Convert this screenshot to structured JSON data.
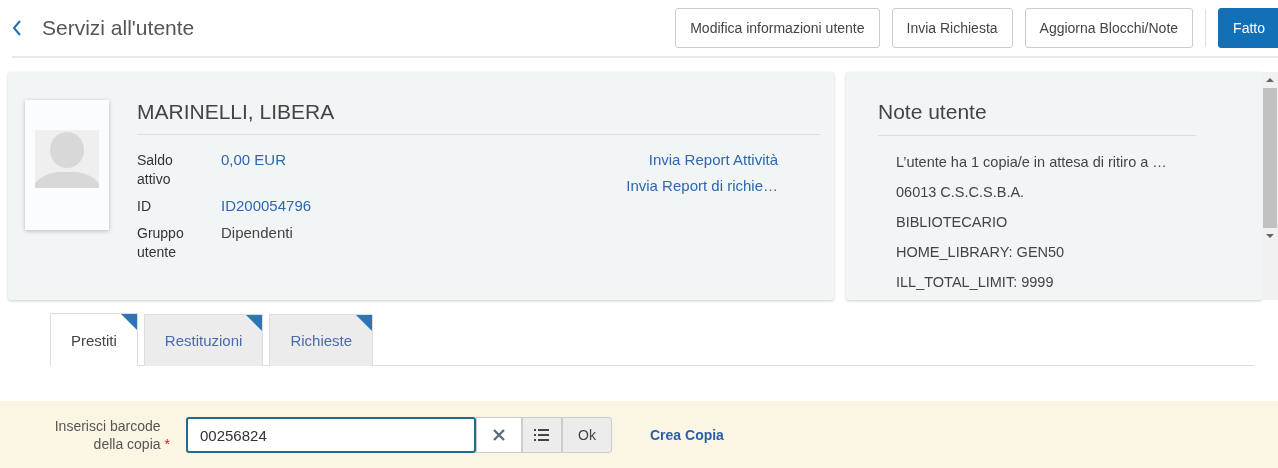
{
  "header": {
    "title": "Servizi all'utente",
    "buttons": [
      {
        "label": "Modifica informazioni utente",
        "kind": "secondary"
      },
      {
        "label": "Invia Richiesta",
        "kind": "secondary"
      },
      {
        "label": "Aggiorna Blocchi/Note",
        "kind": "secondary"
      },
      {
        "label": "Fatto",
        "kind": "primary"
      }
    ]
  },
  "user": {
    "name": "MARINELLI, LIBERA",
    "fields": [
      {
        "label": "Saldo attivo",
        "value": "0,00 EUR",
        "kind": "link"
      },
      {
        "label": "ID",
        "value": "ID200054796",
        "kind": "link"
      },
      {
        "label": "Gruppo utente",
        "value": "Dipendenti",
        "kind": "text"
      }
    ],
    "actions": [
      "Invia Report Attività",
      "Invia Report di richie…"
    ]
  },
  "notes": {
    "title": "Note utente",
    "items": [
      "L’utente ha 1 copia/e in attesa di ritiro a …",
      "06013 C.S.C.S.B.A.",
      "BIBLIOTECARIO",
      "HOME_LIBRARY: GEN50",
      "ILL_TOTAL_LIMIT: 9999"
    ]
  },
  "tabs": [
    {
      "label": "Prestiti",
      "selected": true
    },
    {
      "label": "Restituzioni",
      "selected": false
    },
    {
      "label": "Richieste",
      "selected": false
    }
  ],
  "barcode": {
    "label": "Inserisci barcode della copia",
    "required_mark": "*",
    "value": "00256824",
    "ok": "Ok",
    "link": "Crea Copia"
  }
}
